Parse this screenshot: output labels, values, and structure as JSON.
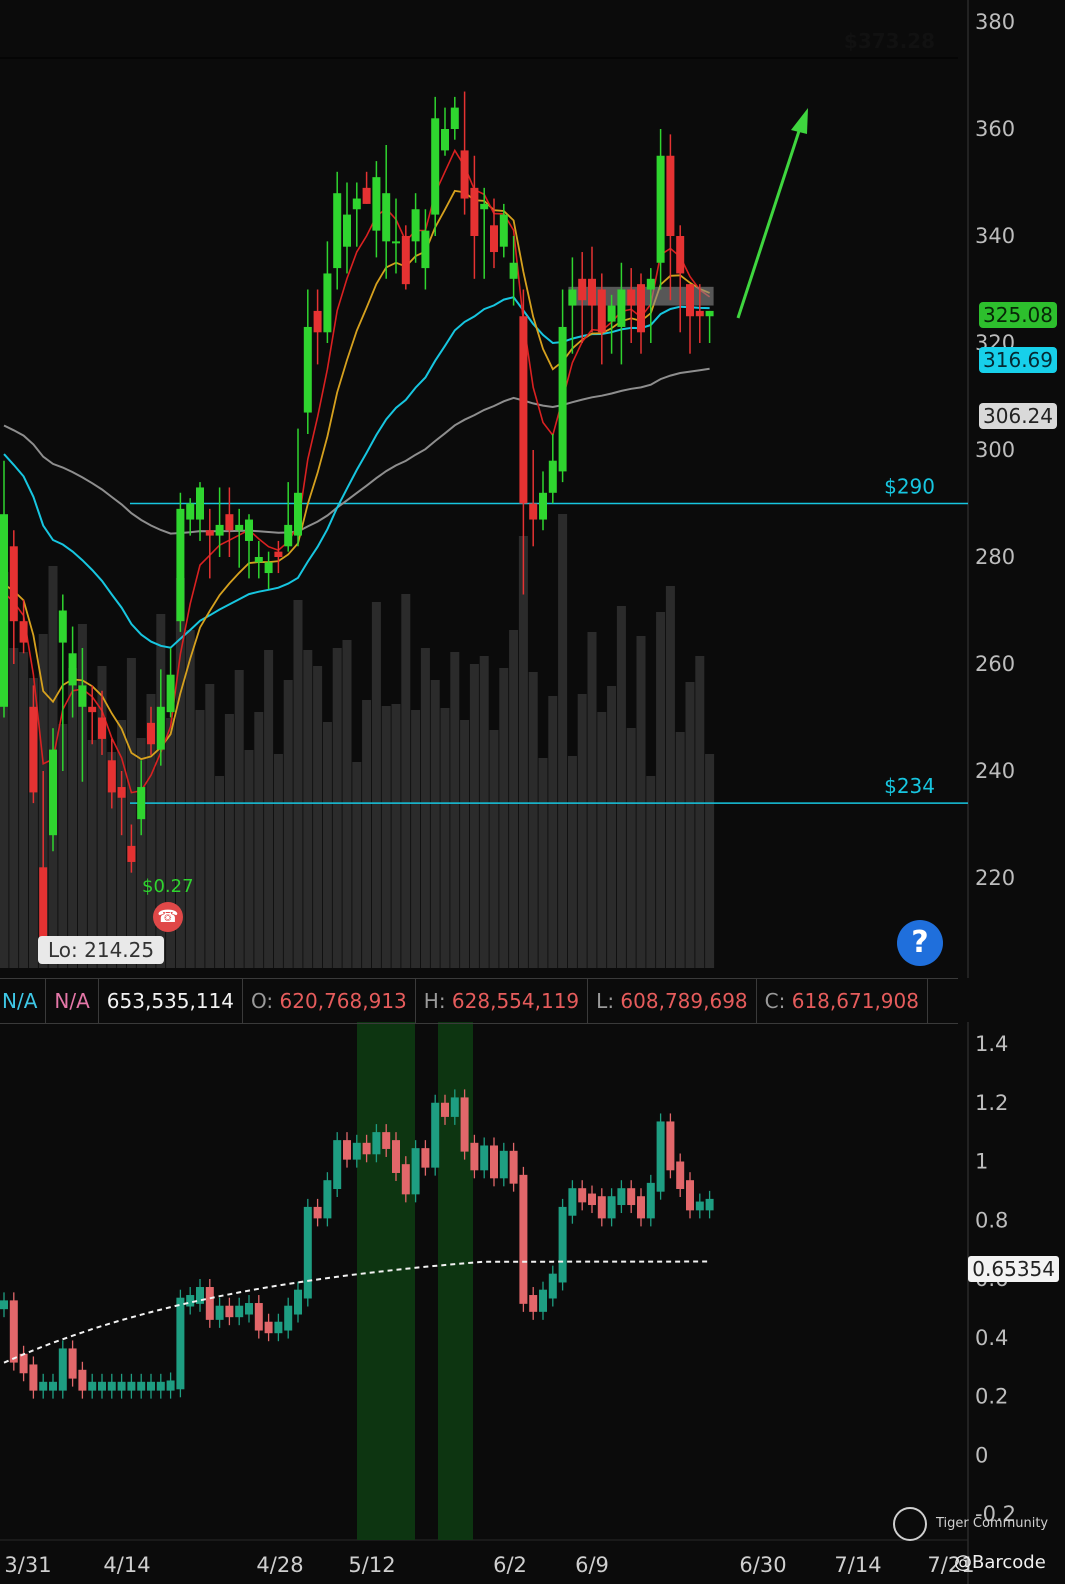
{
  "chart_data": [
    {
      "type": "candlestick",
      "title": "",
      "price_axis": {
        "ticks": [
          380,
          360,
          340,
          320,
          300,
          280,
          260,
          240,
          220
        ],
        "range": [
          203,
          382
        ]
      },
      "date_axis": {
        "ticks": [
          "3/31",
          "4/14",
          "4/28",
          "5/12",
          "6/2",
          "6/9",
          "6/30",
          "7/14",
          "7/21"
        ]
      },
      "candles": [
        [
          252,
          288,
          298,
          250
        ],
        [
          282,
          268,
          285,
          260
        ],
        [
          268,
          264,
          272,
          262
        ],
        [
          252,
          236,
          256,
          234
        ],
        [
          222,
          208,
          240,
          214
        ],
        [
          228,
          244,
          248,
          225
        ],
        [
          264,
          270,
          273,
          240
        ],
        [
          256,
          262,
          267,
          250
        ],
        [
          252,
          256,
          263,
          238
        ],
        [
          252,
          251,
          256,
          245
        ],
        [
          250,
          246,
          255,
          243
        ],
        [
          242,
          236,
          246,
          233
        ],
        [
          237,
          235,
          240,
          228
        ],
        [
          226,
          223,
          230,
          221
        ],
        [
          231,
          237,
          242,
          228
        ],
        [
          249,
          245,
          252,
          243
        ],
        [
          244,
          252,
          259,
          241
        ],
        [
          251,
          258,
          263,
          250
        ],
        [
          268,
          289,
          292,
          266
        ],
        [
          287,
          290,
          291,
          284
        ],
        [
          287,
          293,
          294,
          283
        ],
        [
          285,
          284,
          289,
          276
        ],
        [
          284,
          286,
          293,
          280
        ],
        [
          288,
          285,
          293,
          280
        ],
        [
          285,
          286,
          289,
          278
        ],
        [
          283,
          287,
          288,
          276
        ],
        [
          279,
          280,
          283,
          276
        ],
        [
          277,
          279,
          281,
          274
        ],
        [
          281,
          280,
          283,
          277
        ],
        [
          282,
          286,
          294,
          281
        ],
        [
          284,
          292,
          304,
          282
        ],
        [
          307,
          323,
          330,
          303
        ],
        [
          326,
          322,
          330,
          316
        ],
        [
          322,
          333,
          339,
          320
        ],
        [
          334,
          348,
          352,
          330
        ],
        [
          338,
          344,
          350,
          333
        ],
        [
          345,
          347,
          350,
          338
        ],
        [
          349,
          346,
          352,
          346
        ],
        [
          341,
          351,
          354,
          336
        ],
        [
          339,
          348,
          357,
          332
        ],
        [
          339,
          339,
          347,
          333
        ],
        [
          340,
          331,
          342,
          330
        ],
        [
          339,
          345,
          348,
          335
        ],
        [
          334,
          341,
          345,
          330
        ],
        [
          344,
          362,
          366,
          340
        ],
        [
          356,
          360,
          364,
          355
        ],
        [
          360,
          364,
          366,
          358
        ],
        [
          356,
          347,
          367,
          344
        ],
        [
          349,
          340,
          355,
          332
        ],
        [
          345,
          346,
          349,
          332
        ],
        [
          342,
          337,
          347,
          334
        ],
        [
          338,
          344,
          346,
          336
        ],
        [
          332,
          335,
          340,
          327
        ],
        [
          325,
          290,
          330,
          273
        ],
        [
          290,
          287,
          300,
          282
        ],
        [
          287,
          292,
          296,
          285
        ],
        [
          292,
          298,
          303,
          290
        ],
        [
          296,
          323,
          330,
          294
        ],
        [
          327,
          330,
          336,
          318
        ],
        [
          332,
          328,
          337,
          320
        ],
        [
          332,
          327,
          338,
          322
        ],
        [
          330,
          322,
          333,
          316
        ],
        [
          324,
          327,
          329,
          318
        ],
        [
          323,
          330,
          335,
          316
        ],
        [
          330,
          327,
          334,
          320
        ],
        [
          331,
          322,
          333,
          318
        ],
        [
          330,
          332,
          334,
          320
        ],
        [
          335,
          355,
          360,
          330
        ],
        [
          355,
          340,
          359,
          328
        ],
        [
          340,
          333,
          342,
          322
        ],
        [
          331,
          325,
          331,
          318
        ],
        [
          326,
          325,
          331,
          320
        ],
        [
          325,
          326,
          326,
          320
        ]
      ],
      "price_levels": [
        {
          "label": "$373.28",
          "value": 373.28
        },
        {
          "label": "$290",
          "value": 290
        },
        {
          "label": "$234",
          "value": 234
        }
      ],
      "price_tags": [
        {
          "label": "325.08",
          "value": 325.08,
          "bg": "#2dbf2d",
          "fg": "#072707"
        },
        {
          "label": "316.69",
          "value": 316.69,
          "bg": "#17d0ea",
          "fg": "#052a33"
        },
        {
          "label": "306.24",
          "value": 306.24,
          "bg": "#d9d9d9",
          "fg": "#222222"
        }
      ],
      "annotations": {
        "low_label": "Lo: 214.25",
        "low_value": 214.25,
        "dividend_label": "$0.27"
      }
    },
    {
      "type": "bar",
      "title": "",
      "axis": {
        "ticks": [
          1.4,
          1.2,
          1,
          0.8,
          0.6,
          0.4,
          0.2,
          0,
          -0.2
        ],
        "range": [
          -0.28,
          1.48
        ]
      },
      "value_tag": "0.65354",
      "info_bar": {
        "na_1": "N/A",
        "na_2": "N/A",
        "volume": "653,535,114",
        "open_label": "O:",
        "open": "620,768,913",
        "high_label": "H:",
        "high": "628,554,119",
        "low_label": "L:",
        "low": "608,789,698",
        "close_label": "C:",
        "close": "618,671,908"
      }
    }
  ],
  "colors": {
    "up": "#2fd52f",
    "down": "#e53232",
    "cyan": "#17c6e0",
    "osc_up": "#1e9e82",
    "osc_down": "#e2676a",
    "highlight": "#0d3a12"
  },
  "watermark": {
    "brand": "Tiger Community",
    "handle": "@Barcode"
  },
  "icons": {
    "help": "help-circle-icon",
    "dividend": "phone-icon",
    "logo": "tiger-logo-icon"
  }
}
